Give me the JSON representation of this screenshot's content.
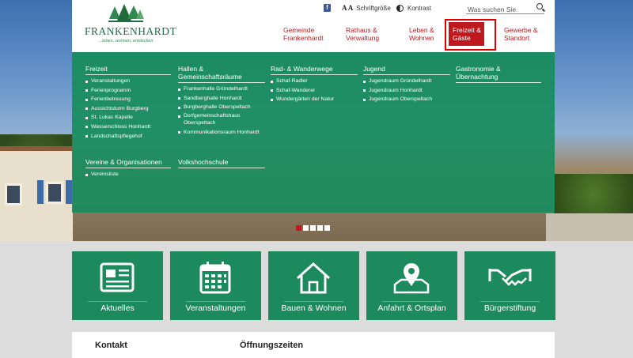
{
  "colors": {
    "brand_green": "#1d8a5e",
    "menu_green": "#188c5c",
    "accent_red": "#c0181f"
  },
  "logo": {
    "name": "FRANKENHARDT",
    "tagline": "...leben, wohnen, entdecken"
  },
  "utility": {
    "font_size_label": "Schriftgröße",
    "font_size_glyph": "A A",
    "contrast_label": "Kontrast",
    "search_placeholder": "Was suchen Sie",
    "facebook_glyph": "f"
  },
  "nav": [
    {
      "line1": "Gemeinde",
      "line2": "Frankenhardt",
      "active": false
    },
    {
      "line1": "Rathaus &",
      "line2": "Verwaltung",
      "active": false
    },
    {
      "line1": "Leben &",
      "line2": "Wohnen",
      "active": false
    },
    {
      "line1": "Freizeit &",
      "line2": "Gäste",
      "active": true
    },
    {
      "line1": "Gewerbe &",
      "line2": "Standort",
      "active": false
    }
  ],
  "mega_menu": {
    "freizeit": {
      "title": "Freizeit",
      "items": [
        "Veranstaltungen",
        "Ferienprogramm",
        "Ferienbetreuung",
        "Aussichtsturm Burgberg",
        "St. Lukas Kapelle",
        "Wasserschloss Honhardt",
        "Landschaftspflegehof"
      ]
    },
    "hallen": {
      "title_line1": "Hallen &",
      "title_line2": "Gemeinschaftsräume",
      "items": [
        "Frankenhalle Gründelhardt",
        "Sandberghalle Honhardt",
        "Burgberghalle Oberspeltach",
        "Dorfgemeinschaftshaus Oberspeltach",
        "Kommunikationsraum Honhardt"
      ]
    },
    "rad": {
      "title": "Rad- & Wanderwege",
      "items": [
        "Schaf-Radler",
        "Schaf-Wanderer",
        "Wundergärten der Natur"
      ]
    },
    "jugend": {
      "title": "Jugend",
      "items": [
        "Jugendraum Gründelhardt",
        "Jugendraum Honhardt",
        "Jugendraum Oberspeltach"
      ]
    },
    "gastronomie": {
      "title_line1": "Gastronomie &",
      "title_line2": "Übernachtung"
    },
    "vereine": {
      "title": "Vereine & Organisationen",
      "items": [
        "Vereinsliste"
      ]
    },
    "vhs": {
      "title": "Volkshochschule"
    }
  },
  "slider": {
    "total_dots": 5,
    "active_dot": 1
  },
  "tiles": [
    {
      "label": "Aktuelles",
      "icon": "newspaper-icon"
    },
    {
      "label": "Veranstaltungen",
      "icon": "calendar-icon"
    },
    {
      "label": "Bauen & Wohnen",
      "icon": "house-icon"
    },
    {
      "label": "Anfahrt & Ortsplan",
      "icon": "map-pin-icon"
    },
    {
      "label": "Bürgerstiftung",
      "icon": "handshake-icon"
    }
  ],
  "info": {
    "contact_title": "Kontakt",
    "hours_title": "Öffnungszeiten"
  }
}
